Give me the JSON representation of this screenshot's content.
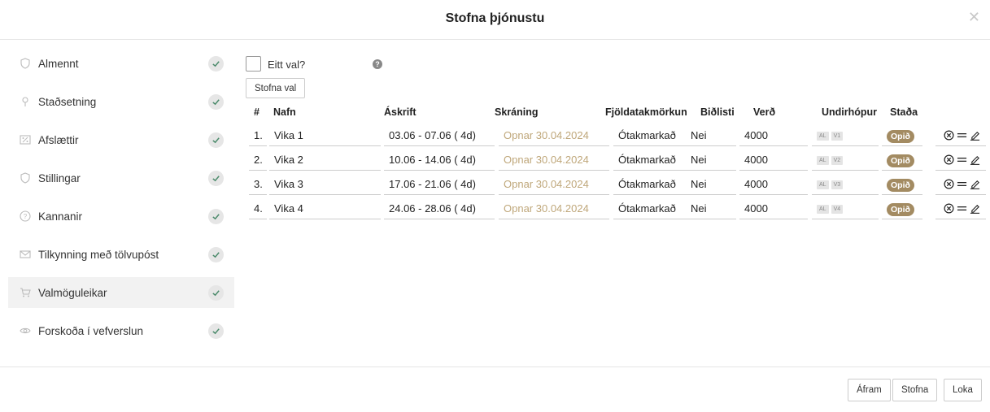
{
  "modal": {
    "title": "Stofna þjónustu"
  },
  "sidebar": {
    "items": [
      {
        "label": "Almennt",
        "icon": "shield-icon"
      },
      {
        "label": "Staðsetning",
        "icon": "pin-icon"
      },
      {
        "label": "Afslættir",
        "icon": "percent-icon"
      },
      {
        "label": "Stillingar",
        "icon": "shield-icon"
      },
      {
        "label": "Kannanir",
        "icon": "question-icon"
      },
      {
        "label": "Tilkynning með tölvupóst",
        "icon": "mail-icon"
      },
      {
        "label": "Valmöguleikar",
        "icon": "cart-icon",
        "active": true
      },
      {
        "label": "Forskoða í vefverslun",
        "icon": "eye-icon"
      }
    ]
  },
  "options": {
    "single_choice_label": "Eitt val?",
    "help_glyph": "?",
    "create_option_label": "Stofna val"
  },
  "table": {
    "headers": {
      "num": "#",
      "name": "Nafn",
      "subscription": "Áskrift",
      "registration": "Skráning",
      "capacity": "Fjöldatakmörkun",
      "waitlist": "Biðlisti",
      "price": "Verð",
      "subgroup": "Undirhópur",
      "status": "Staða"
    },
    "rows": [
      {
        "num": "1.",
        "name": "Vika 1",
        "subscription": "03.06 - 07.06 ( 4d)",
        "registration": "Opnar 30.04.2024",
        "capacity": "Ótakmarkað",
        "waitlist": "Nei",
        "price": "4000",
        "tag1": "AL",
        "tag2": "V1",
        "status": "Opið"
      },
      {
        "num": "2.",
        "name": "Vika 2",
        "subscription": "10.06 - 14.06 ( 4d)",
        "registration": "Opnar 30.04.2024",
        "capacity": "Ótakmarkað",
        "waitlist": "Nei",
        "price": "4000",
        "tag1": "AL",
        "tag2": "V2",
        "status": "Opið"
      },
      {
        "num": "3.",
        "name": "Vika 3",
        "subscription": "17.06 - 21.06 ( 4d)",
        "registration": "Opnar 30.04.2024",
        "capacity": "Ótakmarkað",
        "waitlist": "Nei",
        "price": "4000",
        "tag1": "AL",
        "tag2": "V3",
        "status": "Opið"
      },
      {
        "num": "4.",
        "name": "Vika 4",
        "subscription": "24.06 - 28.06 ( 4d)",
        "registration": "Opnar 30.04.2024",
        "capacity": "Ótakmarkað",
        "waitlist": "Nei",
        "price": "4000",
        "tag1": "AL",
        "tag2": "V4",
        "status": "Opið"
      }
    ]
  },
  "footer": {
    "next_label": "Áfram",
    "create_label": "Stofna",
    "close_label": "Loka"
  },
  "colors": {
    "status_badge": "#a38b62",
    "registration_text": "#bfa77a",
    "check_bg": "#e6e6e6",
    "check_mark": "#4a8a6a"
  }
}
